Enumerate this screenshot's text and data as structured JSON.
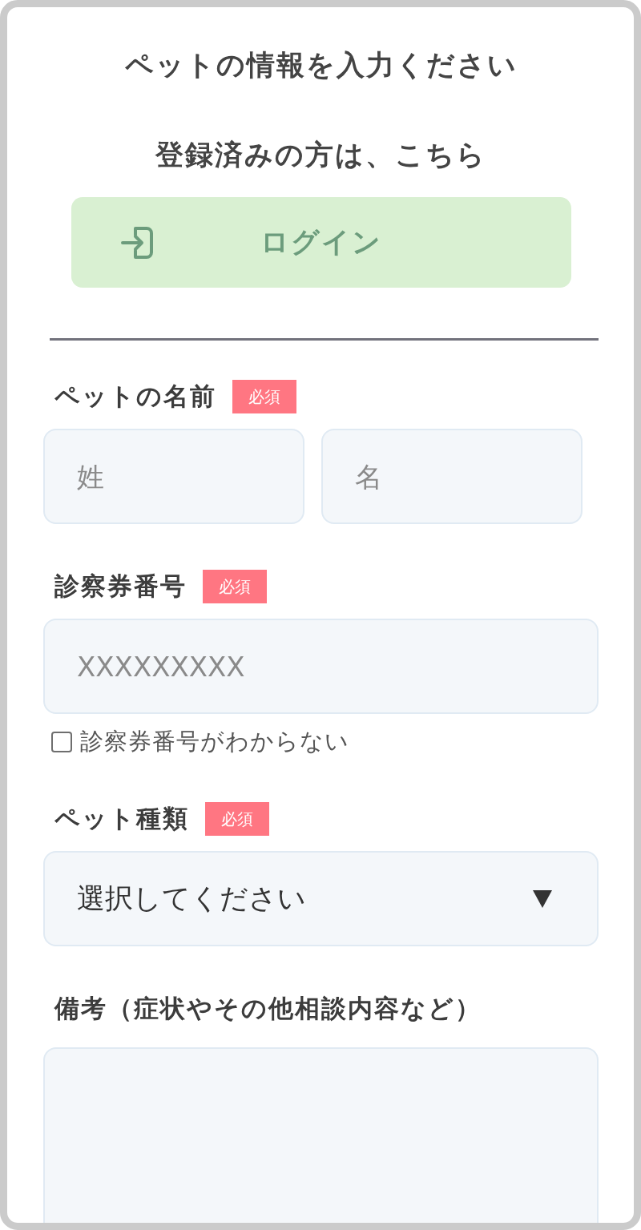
{
  "title": "ペットの情報を入力ください",
  "login": {
    "prompt": "登録済みの方は、こちら",
    "button": "ログイン"
  },
  "sections": [
    {
      "kind": "input",
      "label": "ペットの名前",
      "badge": "必須",
      "fields": [
        {
          "placeholder": "姓"
        },
        {
          "placeholder": "名"
        }
      ]
    },
    {
      "kind": "input",
      "label": "診察券番号",
      "badge": "必須",
      "fields": [
        {
          "placeholder": "XXXXXXXXX"
        }
      ],
      "checkbox": {
        "label": "診察券番号がわからない",
        "checked": false
      }
    },
    {
      "kind": "select",
      "label": "ペット種類",
      "badge": "必須",
      "value": "選択してください"
    },
    {
      "kind": "textarea",
      "label": "備考（症状やその他相談内容など）"
    }
  ]
}
